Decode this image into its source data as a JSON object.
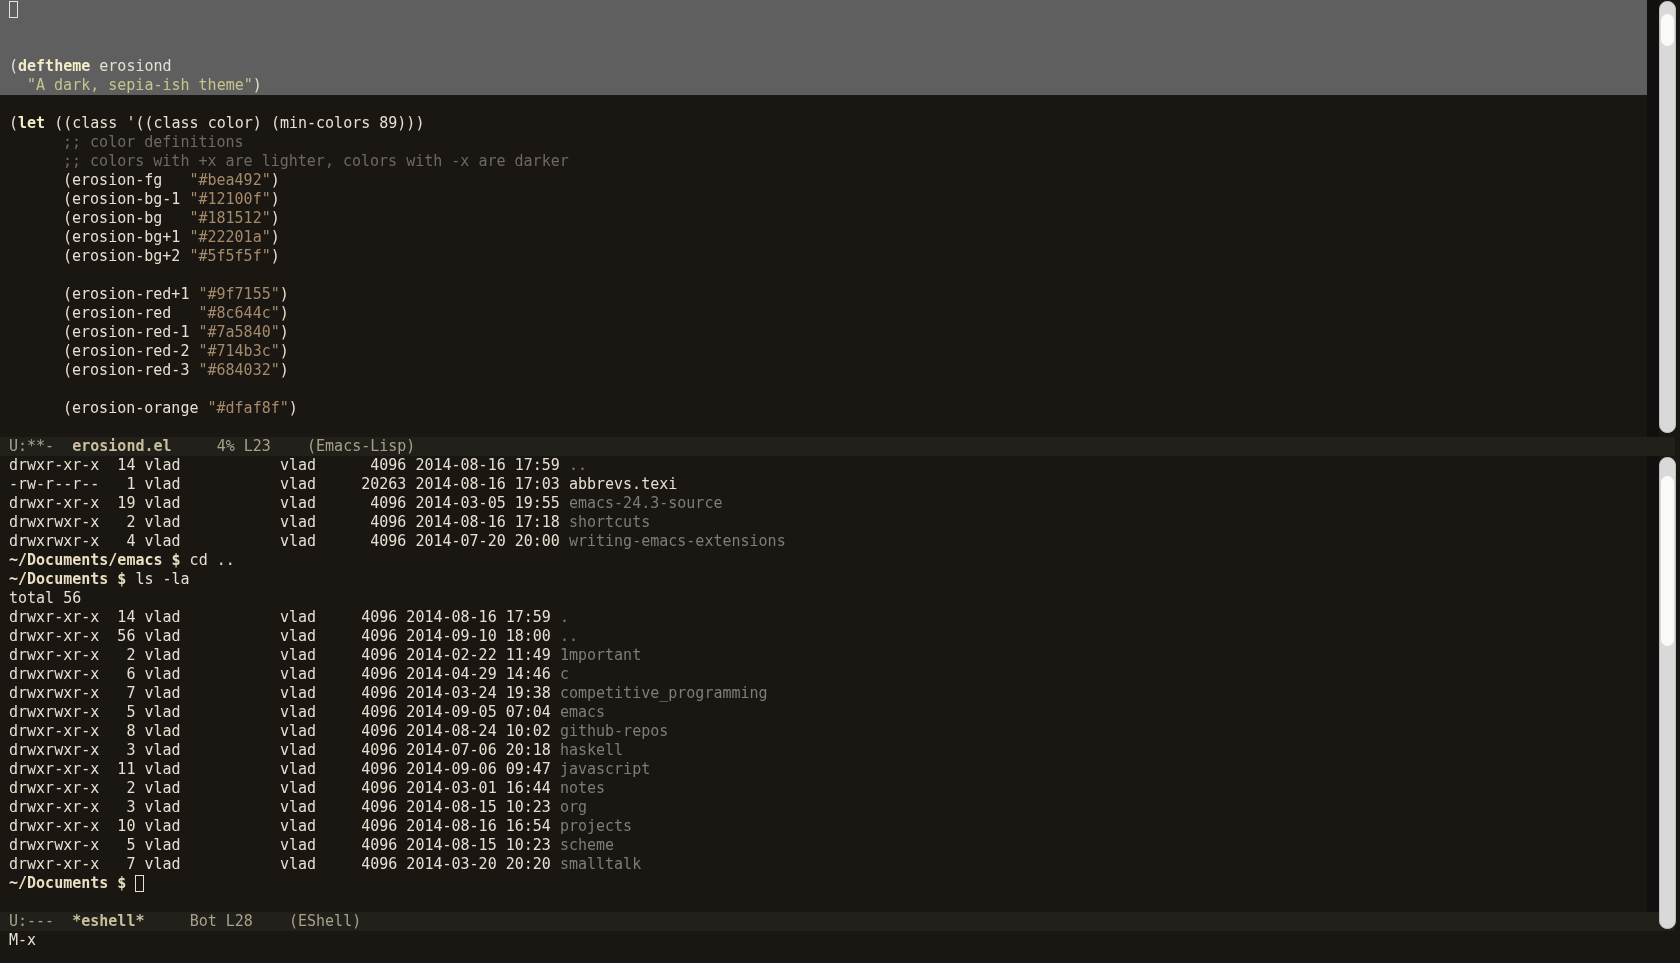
{
  "editor": {
    "lines": [
      {
        "highlighted": true,
        "cursor": true
      },
      {
        "highlighted": true
      },
      {
        "highlighted": true
      },
      {
        "highlighted": true,
        "segments": [
          {
            "kind": "plain",
            "text": "("
          },
          {
            "kind": "keyword",
            "text": "deftheme"
          },
          {
            "kind": "plain",
            "text": " erosiond"
          }
        ]
      },
      {
        "highlighted": true,
        "kind": "docstring",
        "segments": [
          {
            "kind": "doc",
            "text": "\"A dark, sepia-ish theme\""
          },
          {
            "kind": "plain",
            "text": ")"
          }
        ]
      },
      {
        "highlighted": false
      },
      {
        "highlighted": false,
        "segments": [
          {
            "kind": "plain",
            "text": "("
          },
          {
            "kind": "keyword",
            "text": "let"
          },
          {
            "kind": "plain",
            "text": " ((class '((class color) (min-colors 89)))"
          }
        ]
      },
      {
        "highlighted": false,
        "kind": "body",
        "segments": [
          {
            "kind": "comment",
            "text": ";; color definitions"
          }
        ]
      },
      {
        "highlighted": false,
        "kind": "body",
        "segments": [
          {
            "kind": "comment",
            "text": ";; colors with +x are lighter, colors with -x are darker"
          }
        ]
      },
      {
        "highlighted": false,
        "kind": "body",
        "segments": [
          {
            "kind": "plain",
            "text": "(erosion-fg   "
          },
          {
            "kind": "string",
            "text": "\"#bea492\""
          },
          {
            "kind": "plain",
            "text": ")"
          }
        ]
      },
      {
        "highlighted": false,
        "kind": "body",
        "segments": [
          {
            "kind": "plain",
            "text": "(erosion-bg-1 "
          },
          {
            "kind": "string",
            "text": "\"#12100f\""
          },
          {
            "kind": "plain",
            "text": ")"
          }
        ]
      },
      {
        "highlighted": false,
        "kind": "body",
        "segments": [
          {
            "kind": "plain",
            "text": "(erosion-bg   "
          },
          {
            "kind": "string",
            "text": "\"#181512\""
          },
          {
            "kind": "plain",
            "text": ")"
          }
        ]
      },
      {
        "highlighted": false,
        "kind": "body",
        "segments": [
          {
            "kind": "plain",
            "text": "(erosion-bg+1 "
          },
          {
            "kind": "string",
            "text": "\"#22201a\""
          },
          {
            "kind": "plain",
            "text": ")"
          }
        ]
      },
      {
        "highlighted": false,
        "kind": "body",
        "segments": [
          {
            "kind": "plain",
            "text": "(erosion-bg+2 "
          },
          {
            "kind": "string",
            "text": "\"#5f5f5f\""
          },
          {
            "kind": "plain",
            "text": ")"
          }
        ]
      },
      {
        "highlighted": false
      },
      {
        "highlighted": false,
        "kind": "body",
        "segments": [
          {
            "kind": "plain",
            "text": "(erosion-red+1 "
          },
          {
            "kind": "string",
            "text": "\"#9f7155\""
          },
          {
            "kind": "plain",
            "text": ")"
          }
        ]
      },
      {
        "highlighted": false,
        "kind": "body",
        "segments": [
          {
            "kind": "plain",
            "text": "(erosion-red   "
          },
          {
            "kind": "string",
            "text": "\"#8c644c\""
          },
          {
            "kind": "plain",
            "text": ")"
          }
        ]
      },
      {
        "highlighted": false,
        "kind": "body",
        "segments": [
          {
            "kind": "plain",
            "text": "(erosion-red-1 "
          },
          {
            "kind": "string",
            "text": "\"#7a5840\""
          },
          {
            "kind": "plain",
            "text": ")"
          }
        ]
      },
      {
        "highlighted": false,
        "kind": "body",
        "segments": [
          {
            "kind": "plain",
            "text": "(erosion-red-2 "
          },
          {
            "kind": "string",
            "text": "\"#714b3c\""
          },
          {
            "kind": "plain",
            "text": ")"
          }
        ]
      },
      {
        "highlighted": false,
        "kind": "body",
        "segments": [
          {
            "kind": "plain",
            "text": "(erosion-red-3 "
          },
          {
            "kind": "string",
            "text": "\"#684032\""
          },
          {
            "kind": "plain",
            "text": ")"
          }
        ]
      },
      {
        "highlighted": false
      },
      {
        "highlighted": false,
        "kind": "body",
        "segments": [
          {
            "kind": "plain",
            "text": "(erosion-orange "
          },
          {
            "kind": "string",
            "text": "\"#dfaf8f\""
          },
          {
            "kind": "plain",
            "text": ")"
          }
        ]
      },
      {
        "highlighted": false
      }
    ],
    "mode_line": {
      "state": "U:**-",
      "buffer": "erosiond.el",
      "position": "4% L23",
      "mode": "(Emacs-Lisp)"
    }
  },
  "shell": {
    "lines": [
      {
        "segments": [
          {
            "kind": "plain",
            "text": "drwxr-xr-x  14 vlad           vlad      4096 2014-08-16 17:59 "
          },
          {
            "kind": "dir",
            "text": ".."
          }
        ]
      },
      {
        "segments": [
          {
            "kind": "plain",
            "text": "-rw-r--r--   1 vlad           vlad     20263 2014-08-16 17:03 abbrevs.texi"
          }
        ]
      },
      {
        "segments": [
          {
            "kind": "plain",
            "text": "drwxr-xr-x  19 vlad           vlad      4096 2014-03-05 19:55 "
          },
          {
            "kind": "dir",
            "text": "emacs-24.3-source"
          }
        ]
      },
      {
        "segments": [
          {
            "kind": "plain",
            "text": "drwxrwxr-x   2 vlad           vlad      4096 2014-08-16 17:18 "
          },
          {
            "kind": "dir",
            "text": "shortcuts"
          }
        ]
      },
      {
        "segments": [
          {
            "kind": "plain",
            "text": "drwxrwxr-x   4 vlad           vlad      4096 2014-07-20 20:00 "
          },
          {
            "kind": "dir",
            "text": "writing-emacs-extensions"
          }
        ]
      },
      {
        "segments": [
          {
            "kind": "prompt",
            "text": "~/Documents/emacs $"
          },
          {
            "kind": "plain",
            "text": " cd .."
          }
        ]
      },
      {
        "segments": [
          {
            "kind": "prompt",
            "text": "~/Documents $"
          },
          {
            "kind": "plain",
            "text": " ls -la"
          }
        ]
      },
      {
        "segments": [
          {
            "kind": "plain",
            "text": "total 56"
          }
        ]
      },
      {
        "segments": [
          {
            "kind": "plain",
            "text": "drwxr-xr-x  14 vlad           vlad     4096 2014-08-16 17:59 "
          },
          {
            "kind": "dir",
            "text": "."
          }
        ]
      },
      {
        "segments": [
          {
            "kind": "plain",
            "text": "drwxr-xr-x  56 vlad           vlad     4096 2014-09-10 18:00 "
          },
          {
            "kind": "dir",
            "text": ".."
          }
        ]
      },
      {
        "segments": [
          {
            "kind": "plain",
            "text": "drwxr-xr-x   2 vlad           vlad     4096 2014-02-22 11:49 "
          },
          {
            "kind": "dir",
            "text": "1mportant"
          }
        ]
      },
      {
        "segments": [
          {
            "kind": "plain",
            "text": "drwxrwxr-x   6 vlad           vlad     4096 2014-04-29 14:46 "
          },
          {
            "kind": "dir",
            "text": "c"
          }
        ]
      },
      {
        "segments": [
          {
            "kind": "plain",
            "text": "drwxrwxr-x   7 vlad           vlad     4096 2014-03-24 19:38 "
          },
          {
            "kind": "dir",
            "text": "competitive_programming"
          }
        ]
      },
      {
        "segments": [
          {
            "kind": "plain",
            "text": "drwxrwxr-x   5 vlad           vlad     4096 2014-09-05 07:04 "
          },
          {
            "kind": "dir",
            "text": "emacs"
          }
        ]
      },
      {
        "segments": [
          {
            "kind": "plain",
            "text": "drwxr-xr-x   8 vlad           vlad     4096 2014-08-24 10:02 "
          },
          {
            "kind": "dir",
            "text": "github-repos"
          }
        ]
      },
      {
        "segments": [
          {
            "kind": "plain",
            "text": "drwxrwxr-x   3 vlad           vlad     4096 2014-07-06 20:18 "
          },
          {
            "kind": "dir",
            "text": "haskell"
          }
        ]
      },
      {
        "segments": [
          {
            "kind": "plain",
            "text": "drwxr-xr-x  11 vlad           vlad     4096 2014-09-06 09:47 "
          },
          {
            "kind": "dir",
            "text": "javascript"
          }
        ]
      },
      {
        "segments": [
          {
            "kind": "plain",
            "text": "drwxr-xr-x   2 vlad           vlad     4096 2014-03-01 16:44 "
          },
          {
            "kind": "dir",
            "text": "notes"
          }
        ]
      },
      {
        "segments": [
          {
            "kind": "plain",
            "text": "drwxr-xr-x   3 vlad           vlad     4096 2014-08-15 10:23 "
          },
          {
            "kind": "dir",
            "text": "org"
          }
        ]
      },
      {
        "segments": [
          {
            "kind": "plain",
            "text": "drwxr-xr-x  10 vlad           vlad     4096 2014-08-16 16:54 "
          },
          {
            "kind": "dir",
            "text": "projects"
          }
        ]
      },
      {
        "segments": [
          {
            "kind": "plain",
            "text": "drwxrwxr-x   5 vlad           vlad     4096 2014-08-15 10:23 "
          },
          {
            "kind": "dir",
            "text": "scheme"
          }
        ]
      },
      {
        "segments": [
          {
            "kind": "plain",
            "text": "drwxr-xr-x   7 vlad           vlad     4096 2014-03-20 20:20 "
          },
          {
            "kind": "dir",
            "text": "smalltalk"
          }
        ]
      },
      {
        "cursor": true,
        "segments": [
          {
            "kind": "prompt",
            "text": "~/Documents $"
          }
        ]
      }
    ],
    "mode_line": {
      "state": "U:---",
      "buffer": "*eshell*",
      "position": "Bot L28",
      "mode": "(EShell)"
    }
  },
  "minibuffer": "M-x"
}
